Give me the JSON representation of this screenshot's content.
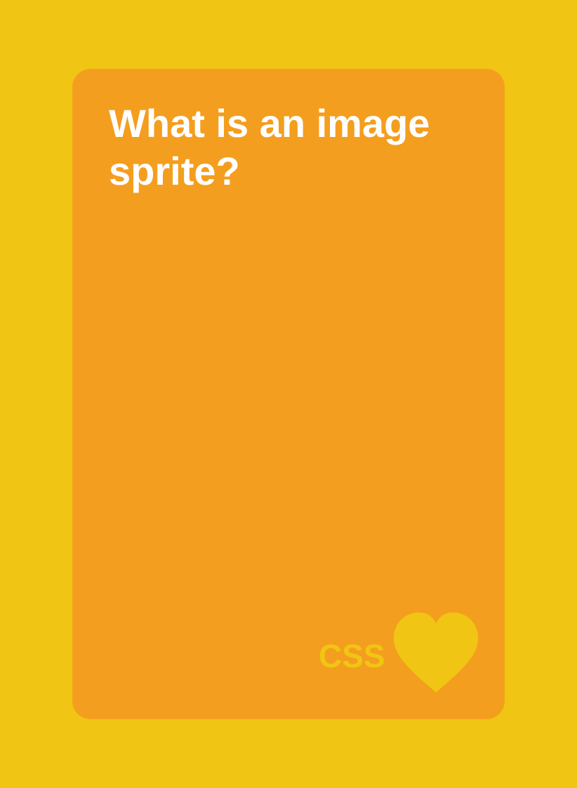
{
  "card": {
    "question": "What is an image sprite?",
    "brand_label": "CSS",
    "brand_icon": "heart-icon"
  },
  "colors": {
    "background": "#F0C513",
    "card": "#F49E1F",
    "question_text": "#FFFFFF",
    "brand": "#F0C513"
  }
}
